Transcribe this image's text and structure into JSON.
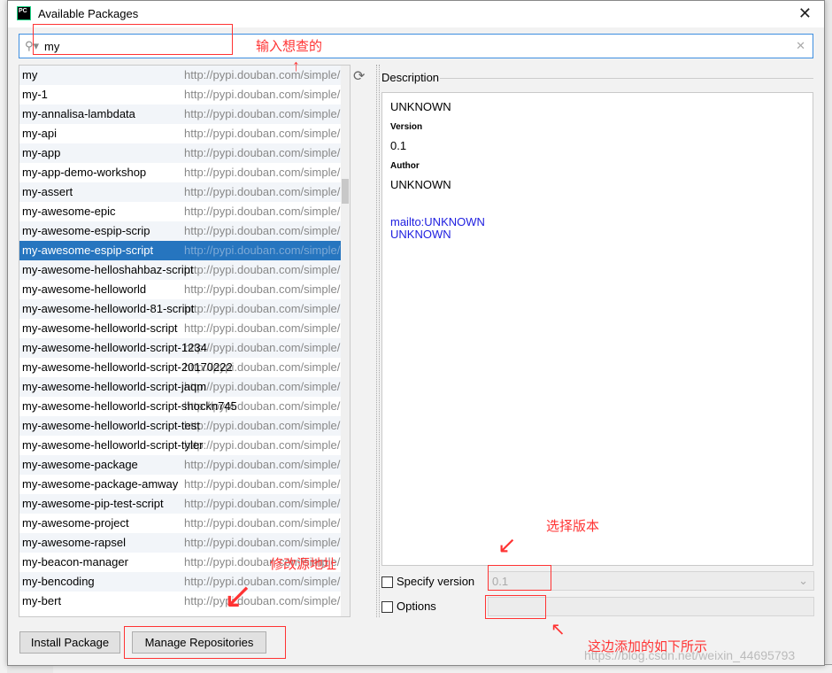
{
  "window": {
    "title": "Available Packages",
    "logo": "PC"
  },
  "search": {
    "value": "my"
  },
  "packages": [
    {
      "name": "my",
      "url": "http://pypi.douban.com/simple/"
    },
    {
      "name": "my-1",
      "url": "http://pypi.douban.com/simple/"
    },
    {
      "name": "my-annalisa-lambdata",
      "url": "http://pypi.douban.com/simple/"
    },
    {
      "name": "my-api",
      "url": "http://pypi.douban.com/simple/"
    },
    {
      "name": "my-app",
      "url": "http://pypi.douban.com/simple/"
    },
    {
      "name": "my-app-demo-workshop",
      "url": "http://pypi.douban.com/simple/"
    },
    {
      "name": "my-assert",
      "url": "http://pypi.douban.com/simple/"
    },
    {
      "name": "my-awesome-epic",
      "url": "http://pypi.douban.com/simple/"
    },
    {
      "name": "my-awesome-espip-scrip",
      "url": "http://pypi.douban.com/simple/"
    },
    {
      "name": "my-awesome-espip-script",
      "url": "http://pypi.douban.com/simple/",
      "selected": true
    },
    {
      "name": "my-awesome-helloshahbaz-script",
      "url": "http://pypi.douban.com/simple/"
    },
    {
      "name": "my-awesome-helloworld",
      "url": "http://pypi.douban.com/simple/"
    },
    {
      "name": "my-awesome-helloworld-81-script",
      "url": "http://pypi.douban.com/simple/"
    },
    {
      "name": "my-awesome-helloworld-script",
      "url": "http://pypi.douban.com/simple/"
    },
    {
      "name": "my-awesome-helloworld-script-1234",
      "url": "http://pypi.douban.com/simple/"
    },
    {
      "name": "my-awesome-helloworld-script-20170222",
      "url": "http://pypi.douban.com/simple/"
    },
    {
      "name": "my-awesome-helloworld-script-jaqm",
      "url": "http://pypi.douban.com/simple/"
    },
    {
      "name": "my-awesome-helloworld-script-shockn745",
      "url": "http://pypi.douban.com/simple/"
    },
    {
      "name": "my-awesome-helloworld-script-test",
      "url": "http://pypi.douban.com/simple/"
    },
    {
      "name": "my-awesome-helloworld-script-tyler",
      "url": "http://pypi.douban.com/simple/"
    },
    {
      "name": "my-awesome-package",
      "url": "http://pypi.douban.com/simple/"
    },
    {
      "name": "my-awesome-package-amway",
      "url": "http://pypi.douban.com/simple/"
    },
    {
      "name": "my-awesome-pip-test-script",
      "url": "http://pypi.douban.com/simple/"
    },
    {
      "name": "my-awesome-project",
      "url": "http://pypi.douban.com/simple/"
    },
    {
      "name": "my-awesome-rapsel",
      "url": "http://pypi.douban.com/simple/"
    },
    {
      "name": "my-beacon-manager",
      "url": "http://pypi.douban.com/simple/"
    },
    {
      "name": "my-bencoding",
      "url": "http://pypi.douban.com/simple/"
    },
    {
      "name": "my-bert",
      "url": "http://pypi.douban.com/simple/"
    }
  ],
  "description": {
    "label": "Description",
    "summary": "UNKNOWN",
    "version_label": "Version",
    "version": "0.1",
    "author_label": "Author",
    "author": "UNKNOWN",
    "mailto": "mailto:UNKNOWN",
    "mail_text": "UNKNOWN"
  },
  "options": {
    "specify_version_label": "Specify version",
    "specify_version_value": "0.1",
    "options_label": "Options"
  },
  "buttons": {
    "install": "Install Package",
    "manage": "Manage Repositories"
  },
  "annotations": {
    "search": "输入想查的",
    "version": "选择版本",
    "repos": "修改源地址",
    "options": "这边添加的如下所示",
    "accent": "#ff3333"
  },
  "watermark": "https://blog.csdn.net/weixin_44695793"
}
